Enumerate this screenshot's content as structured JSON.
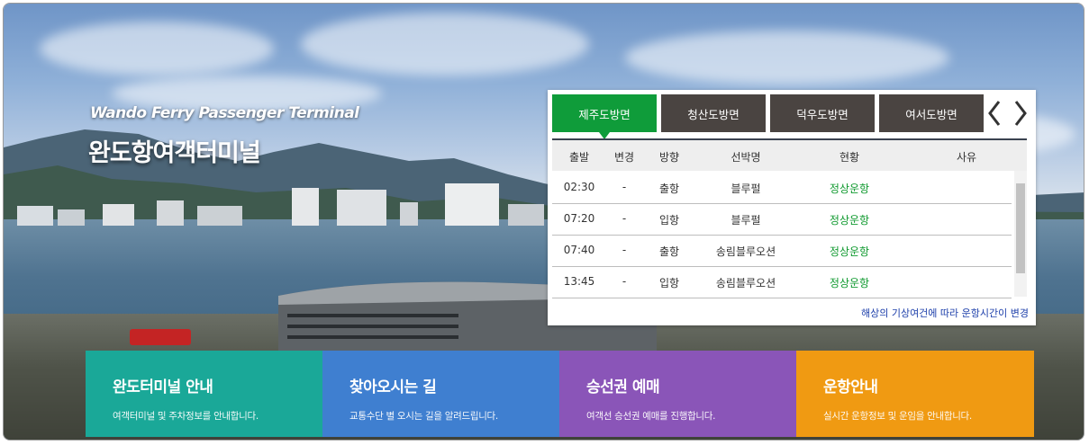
{
  "intro": {
    "title_en": "Wando Ferry Passenger Terminal",
    "title_ko": "완도항여객터미널"
  },
  "schedule": {
    "tabs": [
      {
        "label": "제주도방면",
        "active": true
      },
      {
        "label": "청산도방면",
        "active": false
      },
      {
        "label": "덕우도방면",
        "active": false
      },
      {
        "label": "여서도방면",
        "active": false
      }
    ],
    "prev_icon": "chevron-left-icon",
    "next_icon": "chevron-right-icon",
    "columns": [
      "출발",
      "변경",
      "방향",
      "선박명",
      "현황",
      "사유"
    ],
    "rows": [
      {
        "depart": "02:30",
        "change": "-",
        "direction": "출항",
        "ship": "블루펄",
        "status": "정상운항",
        "reason": ""
      },
      {
        "depart": "07:20",
        "change": "-",
        "direction": "입항",
        "ship": "블루펄",
        "status": "정상운항",
        "reason": ""
      },
      {
        "depart": "07:40",
        "change": "-",
        "direction": "출항",
        "ship": "송림블루오션",
        "status": "정상운항",
        "reason": ""
      },
      {
        "depart": "13:45",
        "change": "-",
        "direction": "입항",
        "ship": "송림블루오션",
        "status": "정상운항",
        "reason": ""
      }
    ],
    "notice": "해상의 기상여건에 따라 운항시간이 변경"
  },
  "cards": [
    {
      "title": "완도터미널 안내",
      "desc": "여객터미널 및 주차정보를 안내합니다.",
      "color": "#1aa898"
    },
    {
      "title": "찾아오시는 길",
      "desc": "교통수단 별 오시는 길을 알려드립니다.",
      "color": "#3f7fd0"
    },
    {
      "title": "승선권 예매",
      "desc": "여객선 승선권 예매를 진행합니다.",
      "color": "#8a55b8"
    },
    {
      "title": "운항안내",
      "desc": "실시간 운항정보 및 운임을 안내합니다.",
      "color": "#f09a12"
    }
  ],
  "colors": {
    "active_tab": "#0f9c3a",
    "inactive_tab": "#4a4441",
    "status_ok": "#119a30",
    "notice": "#1d3faa"
  }
}
